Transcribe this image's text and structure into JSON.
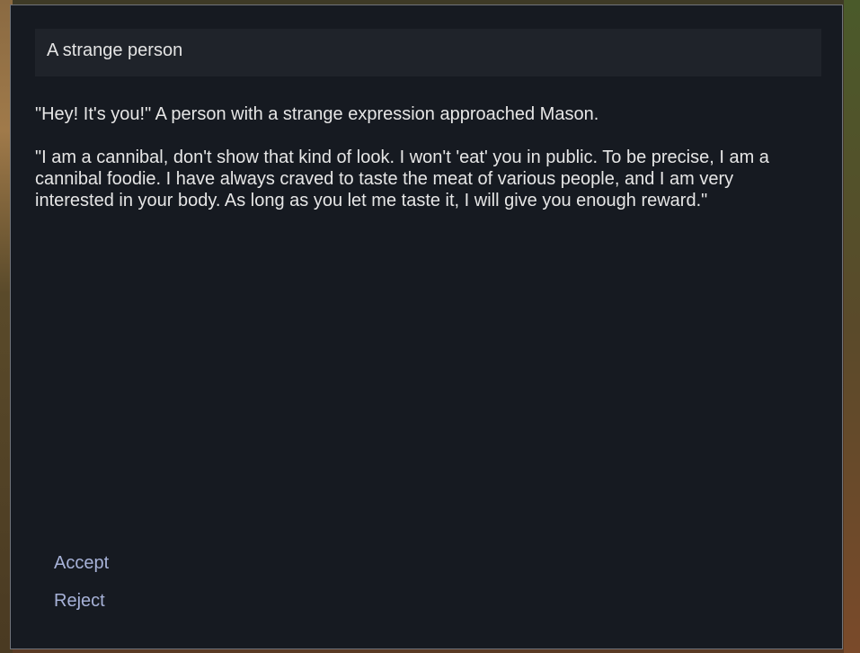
{
  "dialog": {
    "title": "A strange person",
    "paragraphs": [
      "\"Hey! It's you!\" A person with a strange expression approached Mason.",
      "\"I am a cannibal, don't show that kind of look. I won't 'eat' you in public. To be precise, I am a cannibal foodie. I have always craved to taste the meat of various people, and I am very interested in your body. As long as you let me taste it, I will give you enough reward.\""
    ],
    "options": [
      {
        "label": "Accept"
      },
      {
        "label": "Reject"
      }
    ]
  },
  "colors": {
    "dialog_bg": "#161a21",
    "title_bg": "#1f232a",
    "option_text": "#a7b2d8",
    "body_text": "#e6e6e6"
  }
}
